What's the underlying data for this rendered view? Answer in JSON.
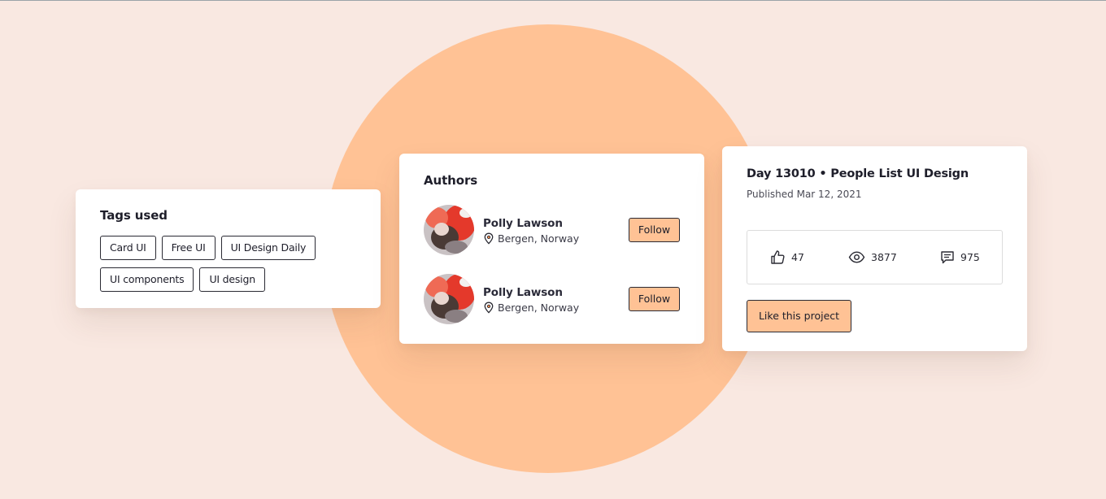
{
  "colors": {
    "background": "#f9e8e1",
    "accent_circle": "#ffc295",
    "button_fill": "#ffc295",
    "card": "#ffffff"
  },
  "tags_card": {
    "title": "Tags used",
    "tags": [
      "Card UI",
      "Free UI",
      "UI Design Daily",
      "UI components",
      "UI design"
    ]
  },
  "authors_card": {
    "title": "Authors",
    "authors": [
      {
        "name": "Polly Lawson",
        "location": "Bergen, Norway",
        "follow_label": "Follow",
        "location_icon": "map-pin-icon"
      },
      {
        "name": "Polly Lawson",
        "location": "Bergen, Norway",
        "follow_label": "Follow",
        "location_icon": "map-pin-icon"
      }
    ]
  },
  "project_card": {
    "title": "Day 13010 • People List UI Design",
    "published": "Published Mar 12, 2021",
    "stats": [
      {
        "icon": "thumbs-up-icon",
        "value": "47"
      },
      {
        "icon": "eye-icon",
        "value": "3877"
      },
      {
        "icon": "comment-icon",
        "value": "975"
      }
    ],
    "button_label": "Like this project"
  }
}
